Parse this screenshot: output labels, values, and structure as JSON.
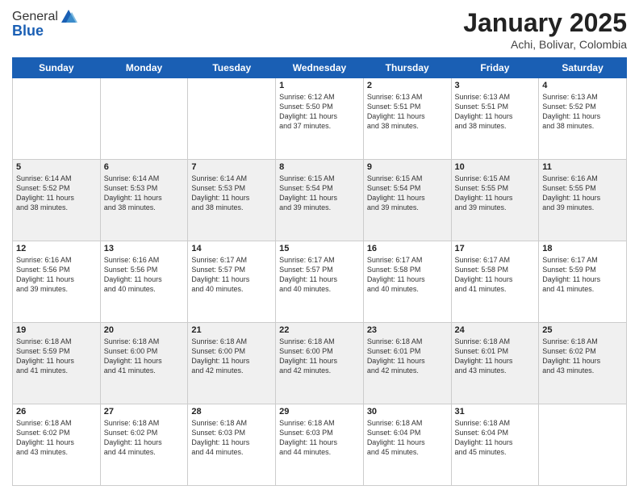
{
  "header": {
    "logo_general": "General",
    "logo_blue": "Blue",
    "month_year": "January 2025",
    "location": "Achi, Bolivar, Colombia"
  },
  "weekdays": [
    "Sunday",
    "Monday",
    "Tuesday",
    "Wednesday",
    "Thursday",
    "Friday",
    "Saturday"
  ],
  "weeks": [
    [
      {
        "day": "",
        "info": ""
      },
      {
        "day": "",
        "info": ""
      },
      {
        "day": "",
        "info": ""
      },
      {
        "day": "1",
        "info": "Sunrise: 6:12 AM\nSunset: 5:50 PM\nDaylight: 11 hours\nand 37 minutes."
      },
      {
        "day": "2",
        "info": "Sunrise: 6:13 AM\nSunset: 5:51 PM\nDaylight: 11 hours\nand 38 minutes."
      },
      {
        "day": "3",
        "info": "Sunrise: 6:13 AM\nSunset: 5:51 PM\nDaylight: 11 hours\nand 38 minutes."
      },
      {
        "day": "4",
        "info": "Sunrise: 6:13 AM\nSunset: 5:52 PM\nDaylight: 11 hours\nand 38 minutes."
      }
    ],
    [
      {
        "day": "5",
        "info": "Sunrise: 6:14 AM\nSunset: 5:52 PM\nDaylight: 11 hours\nand 38 minutes."
      },
      {
        "day": "6",
        "info": "Sunrise: 6:14 AM\nSunset: 5:53 PM\nDaylight: 11 hours\nand 38 minutes."
      },
      {
        "day": "7",
        "info": "Sunrise: 6:14 AM\nSunset: 5:53 PM\nDaylight: 11 hours\nand 38 minutes."
      },
      {
        "day": "8",
        "info": "Sunrise: 6:15 AM\nSunset: 5:54 PM\nDaylight: 11 hours\nand 39 minutes."
      },
      {
        "day": "9",
        "info": "Sunrise: 6:15 AM\nSunset: 5:54 PM\nDaylight: 11 hours\nand 39 minutes."
      },
      {
        "day": "10",
        "info": "Sunrise: 6:15 AM\nSunset: 5:55 PM\nDaylight: 11 hours\nand 39 minutes."
      },
      {
        "day": "11",
        "info": "Sunrise: 6:16 AM\nSunset: 5:55 PM\nDaylight: 11 hours\nand 39 minutes."
      }
    ],
    [
      {
        "day": "12",
        "info": "Sunrise: 6:16 AM\nSunset: 5:56 PM\nDaylight: 11 hours\nand 39 minutes."
      },
      {
        "day": "13",
        "info": "Sunrise: 6:16 AM\nSunset: 5:56 PM\nDaylight: 11 hours\nand 40 minutes."
      },
      {
        "day": "14",
        "info": "Sunrise: 6:17 AM\nSunset: 5:57 PM\nDaylight: 11 hours\nand 40 minutes."
      },
      {
        "day": "15",
        "info": "Sunrise: 6:17 AM\nSunset: 5:57 PM\nDaylight: 11 hours\nand 40 minutes."
      },
      {
        "day": "16",
        "info": "Sunrise: 6:17 AM\nSunset: 5:58 PM\nDaylight: 11 hours\nand 40 minutes."
      },
      {
        "day": "17",
        "info": "Sunrise: 6:17 AM\nSunset: 5:58 PM\nDaylight: 11 hours\nand 41 minutes."
      },
      {
        "day": "18",
        "info": "Sunrise: 6:17 AM\nSunset: 5:59 PM\nDaylight: 11 hours\nand 41 minutes."
      }
    ],
    [
      {
        "day": "19",
        "info": "Sunrise: 6:18 AM\nSunset: 5:59 PM\nDaylight: 11 hours\nand 41 minutes."
      },
      {
        "day": "20",
        "info": "Sunrise: 6:18 AM\nSunset: 6:00 PM\nDaylight: 11 hours\nand 41 minutes."
      },
      {
        "day": "21",
        "info": "Sunrise: 6:18 AM\nSunset: 6:00 PM\nDaylight: 11 hours\nand 42 minutes."
      },
      {
        "day": "22",
        "info": "Sunrise: 6:18 AM\nSunset: 6:00 PM\nDaylight: 11 hours\nand 42 minutes."
      },
      {
        "day": "23",
        "info": "Sunrise: 6:18 AM\nSunset: 6:01 PM\nDaylight: 11 hours\nand 42 minutes."
      },
      {
        "day": "24",
        "info": "Sunrise: 6:18 AM\nSunset: 6:01 PM\nDaylight: 11 hours\nand 43 minutes."
      },
      {
        "day": "25",
        "info": "Sunrise: 6:18 AM\nSunset: 6:02 PM\nDaylight: 11 hours\nand 43 minutes."
      }
    ],
    [
      {
        "day": "26",
        "info": "Sunrise: 6:18 AM\nSunset: 6:02 PM\nDaylight: 11 hours\nand 43 minutes."
      },
      {
        "day": "27",
        "info": "Sunrise: 6:18 AM\nSunset: 6:02 PM\nDaylight: 11 hours\nand 44 minutes."
      },
      {
        "day": "28",
        "info": "Sunrise: 6:18 AM\nSunset: 6:03 PM\nDaylight: 11 hours\nand 44 minutes."
      },
      {
        "day": "29",
        "info": "Sunrise: 6:18 AM\nSunset: 6:03 PM\nDaylight: 11 hours\nand 44 minutes."
      },
      {
        "day": "30",
        "info": "Sunrise: 6:18 AM\nSunset: 6:04 PM\nDaylight: 11 hours\nand 45 minutes."
      },
      {
        "day": "31",
        "info": "Sunrise: 6:18 AM\nSunset: 6:04 PM\nDaylight: 11 hours\nand 45 minutes."
      },
      {
        "day": "",
        "info": ""
      }
    ]
  ]
}
